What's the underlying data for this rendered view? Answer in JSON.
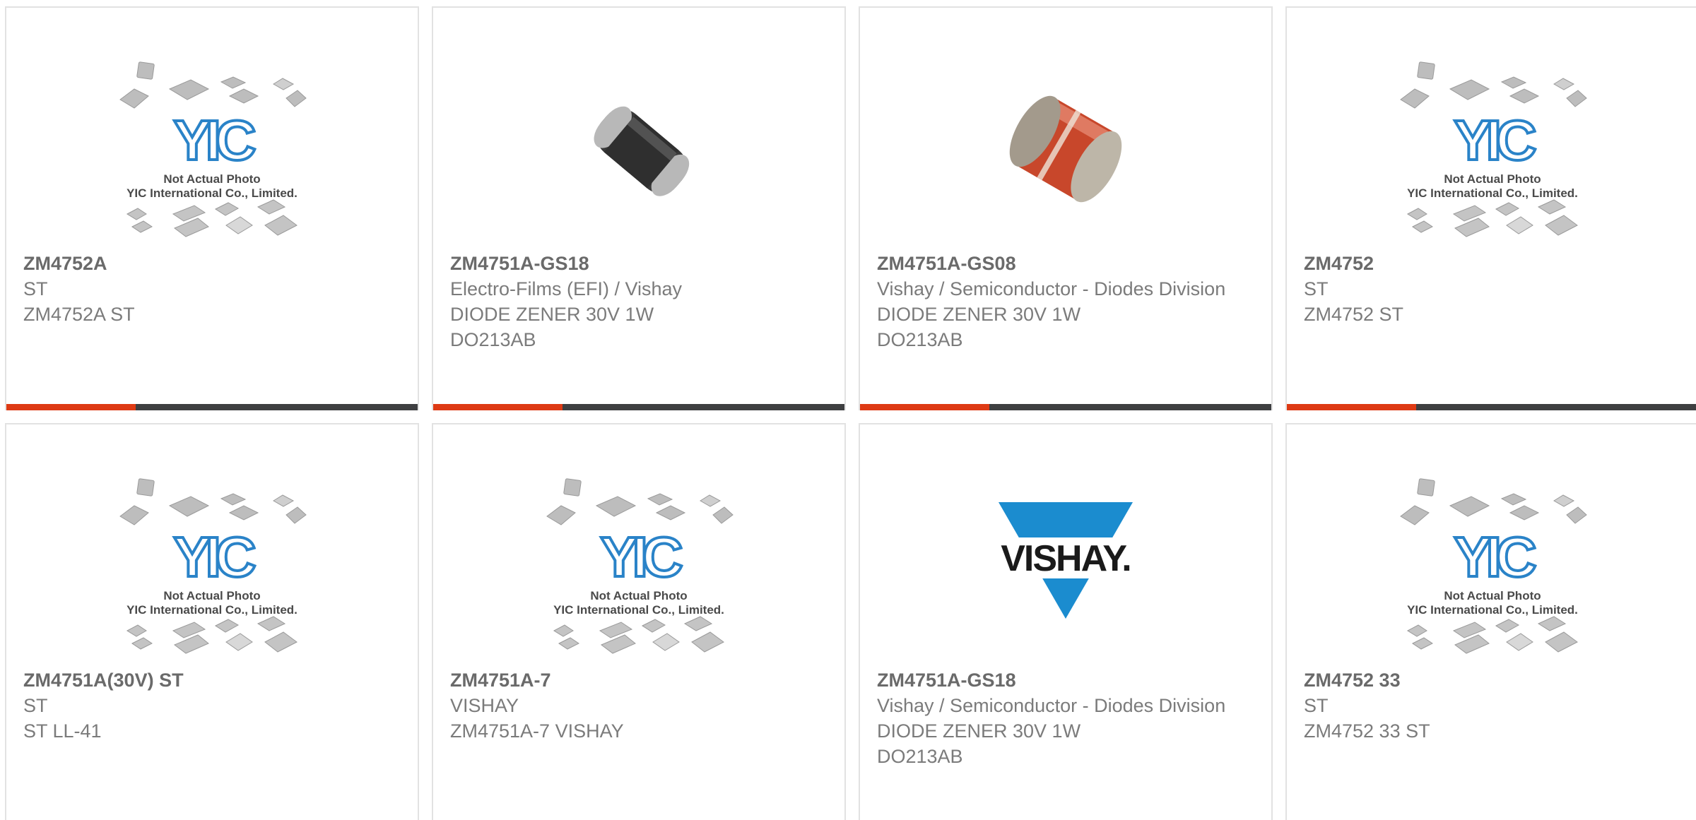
{
  "colors": {
    "accent": "#de3a14",
    "bar": "#3e3f41",
    "card_border": "#e2e2e2",
    "text_bold": "#6a6a6a",
    "text": "#7b7b7b",
    "yic_blue": "#2a83c8",
    "vishay_blue": "#1b8ccf"
  },
  "placeholder_text": {
    "line1": "Not Actual Photo",
    "line2": "YIC International Co., Limited.",
    "logo": "YIC"
  },
  "vishay_logo_text": "VISHAY.",
  "products": [
    {
      "part_number": "ZM4752A",
      "manufacturer": "ST",
      "description_lines": [
        "ZM4752A ST"
      ],
      "image": "yic-placeholder"
    },
    {
      "part_number": "ZM4751A-GS18",
      "manufacturer": "Electro-Films (EFI) / Vishay",
      "description_lines": [
        "DIODE ZENER 30V 1W",
        "DO213AB"
      ],
      "image": "black-melf-diode"
    },
    {
      "part_number": "ZM4751A-GS08",
      "manufacturer": "Vishay / Semiconductor - Diodes Division",
      "description_lines": [
        "DIODE ZENER 30V 1W",
        "DO213AB"
      ],
      "image": "red-glass-diode"
    },
    {
      "part_number": "ZM4752",
      "manufacturer": "ST",
      "description_lines": [
        "ZM4752 ST"
      ],
      "image": "yic-placeholder"
    },
    {
      "part_number": "ZM4751A(30V) ST",
      "manufacturer": "ST",
      "description_lines": [
        "ST LL-41"
      ],
      "image": "yic-placeholder"
    },
    {
      "part_number": "ZM4751A-7",
      "manufacturer": "VISHAY",
      "description_lines": [
        "ZM4751A-7 VISHAY"
      ],
      "image": "yic-placeholder"
    },
    {
      "part_number": "ZM4751A-GS18",
      "manufacturer": "Vishay / Semiconductor - Diodes Division",
      "description_lines": [
        "DIODE ZENER 30V 1W",
        "DO213AB"
      ],
      "image": "vishay-logo"
    },
    {
      "part_number": "ZM4752 33",
      "manufacturer": "ST",
      "description_lines": [
        "ZM4752 33 ST"
      ],
      "image": "yic-placeholder"
    }
  ]
}
